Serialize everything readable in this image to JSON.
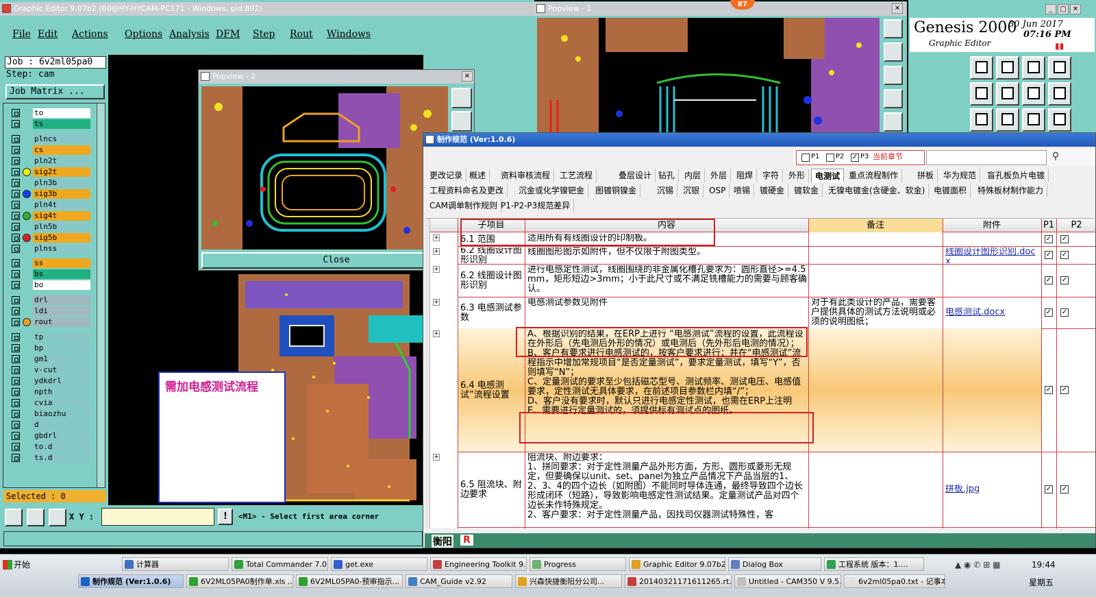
{
  "main_window": {
    "title": "Graphic Editor 9.07b2 (00@HY-HYCAM-PC171 - Windows, pid:892)",
    "menu": [
      "File",
      "Edit",
      "Actions",
      "Options",
      "Analysis",
      "DFM",
      "Step",
      "Rout",
      "Windows"
    ],
    "job": "Job : 6v2ml05pa0",
    "step": "Step: cam",
    "job_matrix": "Job Matrix ...",
    "selected": "Selected : 0",
    "xy_label": "X Y :",
    "status_msg": "<M1> - Select first area corner",
    "layers": [
      {
        "name": "to",
        "color": "#ffffff",
        "dot": ""
      },
      {
        "name": "ts",
        "color": "#20b080",
        "dot": ""
      },
      {
        "name": "plncs",
        "color": "#88c8c8",
        "dot": ""
      },
      {
        "name": "cs",
        "color": "#f0a820",
        "dot": ""
      },
      {
        "name": "pln2t",
        "color": "#88c8c8",
        "dot": ""
      },
      {
        "name": "sig2t",
        "color": "#f0a820",
        "dot": "#f0f000"
      },
      {
        "name": "pln3b",
        "color": "#88c8c8",
        "dot": ""
      },
      {
        "name": "sig3b",
        "color": "#f0a820",
        "dot": "#1040f0"
      },
      {
        "name": "pln4t",
        "color": "#88c8c8",
        "dot": ""
      },
      {
        "name": "sig4t",
        "color": "#f0a820",
        "dot": "#30b030"
      },
      {
        "name": "pln5b",
        "color": "#88c8c8",
        "dot": ""
      },
      {
        "name": "sig5b",
        "color": "#f0a820",
        "dot": "#e02020"
      },
      {
        "name": "plnss",
        "color": "#88c8c8",
        "dot": ""
      },
      {
        "name": "ss",
        "color": "#f0a820",
        "dot": ""
      },
      {
        "name": "bs",
        "color": "#20b080",
        "dot": ""
      },
      {
        "name": "bo",
        "color": "#ffffff",
        "dot": ""
      },
      {
        "name": "drl",
        "color": "#a0b8c0",
        "dot": ""
      },
      {
        "name": "ldi",
        "color": "#a0b8c0",
        "dot": ""
      },
      {
        "name": "rout",
        "color": "#a0b8c0",
        "dot": "#f0a020"
      },
      {
        "name": "tp",
        "color": "#88c8c8",
        "dot": ""
      },
      {
        "name": "bp",
        "color": "#88c8c8",
        "dot": ""
      },
      {
        "name": "gm1",
        "color": "#88c8c8",
        "dot": ""
      },
      {
        "name": "v-cut",
        "color": "#88c8c8",
        "dot": ""
      },
      {
        "name": "ydkdrl",
        "color": "#88c8c8",
        "dot": ""
      },
      {
        "name": "npth",
        "color": "#88c8c8",
        "dot": ""
      },
      {
        "name": "cvia",
        "color": "#88c8c8",
        "dot": ""
      },
      {
        "name": "biaozhu",
        "color": "#88c8c8",
        "dot": ""
      },
      {
        "name": "d",
        "color": "#88c8c8",
        "dot": ""
      },
      {
        "name": "gbdrl",
        "color": "#88c8c8",
        "dot": ""
      },
      {
        "name": "to.d",
        "color": "#88c8c8",
        "dot": ""
      },
      {
        "name": "ts.d",
        "color": "#88c8c8",
        "dot": ""
      }
    ]
  },
  "popview1": {
    "title": "Popview - 1"
  },
  "popview2": {
    "title": "Popview - 2",
    "close": "Close"
  },
  "genesis": {
    "title": "Genesis 2000",
    "subtitle": "Graphic Editor",
    "date": "30 Jun 2017",
    "time": "07:16 PM",
    "badge": "87"
  },
  "note": {
    "text": "需加电感测试流程"
  },
  "spec": {
    "title": "制作规范 (Ver:1.0.6)",
    "filters": {
      "p1": "P1",
      "p2": "P2",
      "p3": "P3",
      "scope": "当前章节"
    },
    "tabs_row1": [
      "更改记录",
      "概述",
      "资料审核流程",
      "工艺流程",
      "叠层设计",
      "钻孔",
      "内层",
      "外层",
      "阻焊",
      "字符",
      "外形",
      "电测试",
      "重点流程制作",
      "拼板",
      "华为规范",
      "盲孔板负片电镀"
    ],
    "tabs_row2": [
      "工程资料命名及更改",
      "沉金或化学镍钯金",
      "图镀铜镍金",
      "沉锡",
      "沉银",
      "OSP",
      "喷锡",
      "镀硬金",
      "镀软金",
      "无镍电镀金(含硬金、软金)",
      "电镀面积",
      "特殊板材制作能力"
    ],
    "tabs_row3": [
      "CAM调单制作规则",
      "P1-P2-P3规范差异"
    ],
    "columns": [
      "子项目",
      "内容",
      "备注",
      "附件",
      "P1",
      "P2"
    ],
    "rows": [
      {
        "sub": "6.1 范围",
        "content": "适用所有有线圈设计的印制板。",
        "remark": "",
        "attach": ""
      },
      {
        "sub": "6.2 线圈设计图形识别",
        "content": "线圈图形图示如附件，但不仅限于附图类型。",
        "remark": "",
        "attach": "线圈设计图形识别.docx"
      },
      {
        "sub": "6.2 线圈设计图形识别",
        "content": "进行电感定性测试，线圈围绕的非金属化槽孔要求为：圆形直径>=4.5mm，矩形短边>3mm；小于此尺寸或不满足铣槽能力的需要与顾客确认。",
        "remark": "",
        "attach": ""
      },
      {
        "sub": "6.3 电感测试参数",
        "content": "电感测试参数见附件",
        "remark": "对于有此类设计的产品，需要客户提供具体的测试方法说明或必须的说明图纸；",
        "attach": "电感测试.docx"
      },
      {
        "sub": "6.4 电感测试”流程设置",
        "content": "A、根据识别的结果，在ERP上进行 “电感测试”流程的设置，此流程设在外形后（先电测后外形的情况）或电测后（先外形后电测的情况）；\nB、客户有要求进行电感测试的，按客户要求进行；并在“电感测试”流程指示中增加常规项目“是否定量测试”，要求定量测试，填写“Y”，否则填写“N”；\nC、定量测试的要求至少包括磁芯型号、测试频率、测试电压、电感值要求，定性测试无具体要求，在前述项目参数栏内填“/”；\nD、客户没有要求时，默认只进行电感定性测试，也需在ERP上注明\nE、需要进行定量测试的，须提供标有测试点的图纸。",
        "remark": "",
        "attach": ""
      },
      {
        "sub": "6.5 阻流块、附边要求",
        "content": "阻流块、附边要求：\n1、拼同要求：对于定性测量产品外形方面，方形、圆形或菱形无规定，但要确保以unit、set、panel为独立产品情况下产品当层的1、2、3、4的四个边长（如附图）不能同时导体连通，最终导致四个边长形成闭环（短路），导致影响电感定性测试结果。定量测试产品对四个边长未作特殊规定。\n2、客户要求：对于定性测量产品，因找司仪器测试特殊性，客",
        "remark": "",
        "attach": "拼板.jpg"
      }
    ],
    "footer": "衡阳",
    "footer_r": "R"
  },
  "taskbar": {
    "start": "开始",
    "row1": [
      "计算器",
      "Total Commander 7.0...",
      "get.exe",
      "Engineering Toolkit 9....",
      "Progress",
      "Graphic Editor 9.07b2...",
      "Dialog Box",
      "工程系统  版本：1...."
    ],
    "row2": [
      "制作规范 (Ver:1.0.6)",
      "6V2ML05PA0制作单.xls ...",
      "6V2ML05PA0-预审指示...",
      "CAM_Guide v2.92",
      "兴森快捷衡阳分公司...",
      "20140321171611265.rt...",
      "Untitled - CAM350 V 9.5.2",
      "6v2ml05pa0.txt - 记事本"
    ],
    "time": "19:44",
    "weekday": "星期五"
  }
}
